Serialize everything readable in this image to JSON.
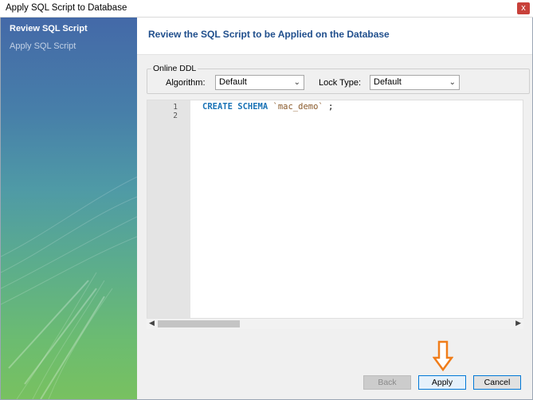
{
  "window": {
    "title": "Apply SQL Script to Database",
    "close_glyph": "x"
  },
  "sidebar": {
    "items": [
      {
        "label": "Review SQL Script",
        "state": "active"
      },
      {
        "label": "Apply SQL Script",
        "state": "pending"
      }
    ]
  },
  "main": {
    "heading": "Review the SQL Script to be Applied on the Database",
    "online_ddl": {
      "legend": "Online DDL",
      "algorithm_label": "Algorithm:",
      "algorithm_value": "Default",
      "lock_type_label": "Lock Type:",
      "lock_type_value": "Default"
    },
    "editor": {
      "line_numbers": [
        "1",
        "2"
      ],
      "code_keyword": "CREATE SCHEMA",
      "code_identifier": "`mac_demo`",
      "code_end": " ;"
    }
  },
  "footer": {
    "back_label": "Back",
    "apply_label": "Apply",
    "cancel_label": "Cancel"
  },
  "annotation": {
    "arrow_icon": "down-arrow-icon",
    "arrow_color": "#f07d1a"
  },
  "colors": {
    "heading": "#1f4e8c",
    "keyword": "#1a73b6",
    "identifier": "#8a5a2b",
    "focus_border": "#0078d7"
  }
}
